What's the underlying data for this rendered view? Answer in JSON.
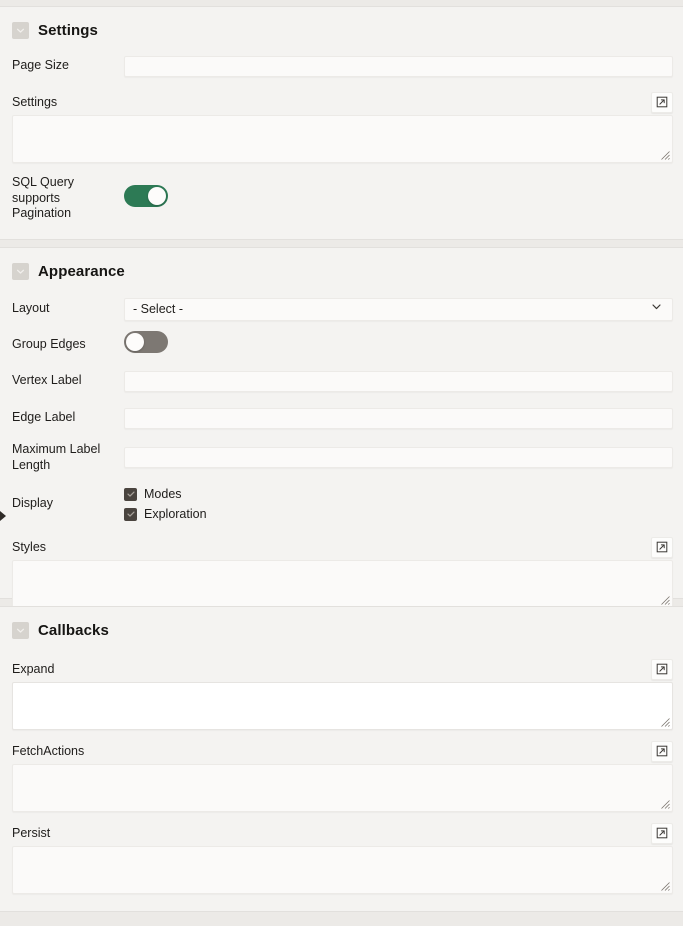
{
  "theme": {
    "page_bg": "#eceae7",
    "panel_bg": "#f4f3f1",
    "field_bg": "#fbfaf9",
    "toggle_on_color": "#2d7a55",
    "toggle_off_color": "#7d7873",
    "checkbox_color": "#4a443f",
    "text_color": "#1f1d1b"
  },
  "icons": {
    "collapse_chevron": "chevron-down-icon",
    "select_chevron": "chevron-down-icon",
    "popout": "popout-expand-icon",
    "checkmark": "check-icon",
    "panel_handle": "panel-expand-handle-icon",
    "resize_grip": "resize-grip-icon"
  },
  "sections": [
    {
      "id": "settings",
      "title": "Settings",
      "fields": {
        "page_size": {
          "label": "Page Size",
          "value": "",
          "placeholder": ""
        },
        "settings": {
          "label": "Settings",
          "value": "",
          "placeholder": "",
          "popout_label": "Open in editor"
        },
        "sql_pagination": {
          "label": "SQL Query supports Pagination",
          "state": "on",
          "state_text": "On"
        }
      }
    },
    {
      "id": "appearance",
      "title": "Appearance",
      "fields": {
        "layout": {
          "label": "Layout",
          "value": "- Select -",
          "options": [
            "- Select -"
          ]
        },
        "group_edges": {
          "label": "Group Edges",
          "state": "off",
          "state_text": "Off"
        },
        "vertex_label": {
          "label": "Vertex Label",
          "value": "",
          "placeholder": ""
        },
        "edge_label": {
          "label": "Edge Label",
          "value": "",
          "placeholder": ""
        },
        "maximum_label_length": {
          "label": "Maximum Label Length",
          "value": "",
          "placeholder": ""
        },
        "display": {
          "label": "Display",
          "checkboxes": [
            {
              "label": "Modes",
              "checked": true
            },
            {
              "label": "Exploration",
              "checked": true
            }
          ]
        },
        "styles": {
          "label": "Styles",
          "value": "",
          "placeholder": "",
          "popout_label": "Open in editor"
        }
      }
    },
    {
      "id": "callbacks",
      "title": "Callbacks",
      "fields": {
        "expand": {
          "label": "Expand",
          "value": "",
          "placeholder": "",
          "popout_label": "Open in editor",
          "focused": true
        },
        "fetch_actions": {
          "label": "FetchActions",
          "value": "",
          "placeholder": "",
          "popout_label": "Open in editor",
          "focused": false
        },
        "persist": {
          "label": "Persist",
          "value": "",
          "placeholder": "",
          "popout_label": "Open in editor",
          "focused": false
        }
      }
    }
  ]
}
